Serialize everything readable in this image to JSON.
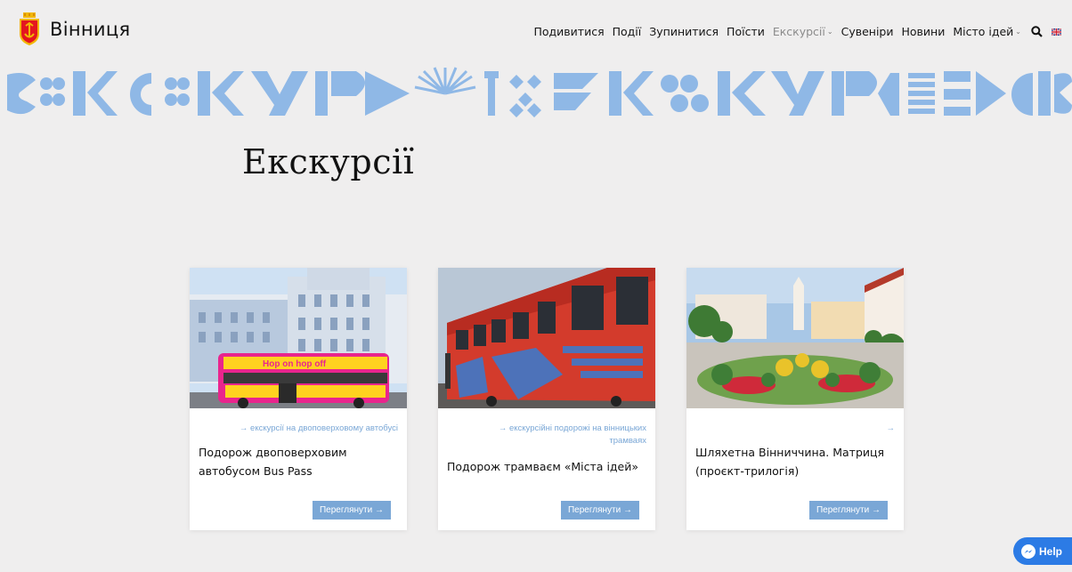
{
  "brand": {
    "name": "Вінниця"
  },
  "nav": [
    {
      "label": "Подивитися"
    },
    {
      "label": "Події"
    },
    {
      "label": "Зупинитися"
    },
    {
      "label": "Поїсти"
    },
    {
      "label": "Екскурсії",
      "dropdown": true,
      "active": true
    },
    {
      "label": "Сувеніри"
    },
    {
      "label": "Новини"
    },
    {
      "label": "Місто ідей",
      "dropdown": true
    }
  ],
  "page": {
    "title": "Екскурсії"
  },
  "cards": [
    {
      "tag": "→ екскурсії на двоповерховому автобусі",
      "title": "Подорож двоповерховим автобусом Bus Pass",
      "button": "Переглянути →",
      "image_text": "Hop on hop off"
    },
    {
      "tag": "→ екскурсійні подорожі на вінницьких трамваях",
      "title": "Подорож трамваєм «Міста ідей»",
      "button": "Переглянути →"
    },
    {
      "tag": "→",
      "title": "Шляхетна Вінниччина. Матриця (проєкт-трилогія)",
      "button": "Переглянути →"
    }
  ],
  "help": {
    "label": "Help"
  },
  "colors": {
    "accent": "#7aa7d6",
    "banner": "#8fb8e6",
    "background": "#efeeee",
    "help": "#2c7be5"
  }
}
